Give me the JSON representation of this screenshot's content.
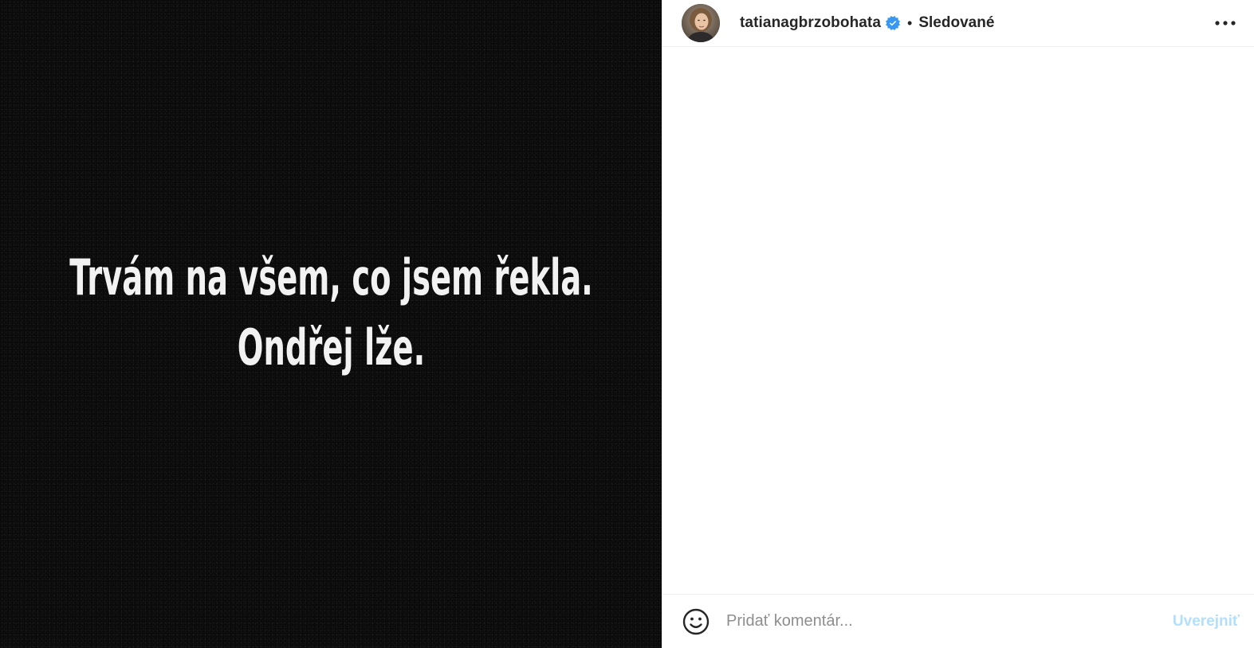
{
  "post": {
    "image_text_lines": [
      "Trvám na všem, co jsem řekla.",
      "Ondřej lže."
    ]
  },
  "header": {
    "username": "tatianagbrzobohata",
    "verified": true,
    "separator": "•",
    "follow_status": "Sledované",
    "more_icon": "more-horizontal-icon",
    "avatar_icon": "profile-photo"
  },
  "comment_bar": {
    "emoji_icon": "smiley-face-icon",
    "placeholder": "Pridať komentár...",
    "post_label": "Uverejniť"
  },
  "colors": {
    "verified_badge": "#3897f0",
    "post_button_disabled": "#b2dffc",
    "media_background": "#0b0b0b"
  }
}
